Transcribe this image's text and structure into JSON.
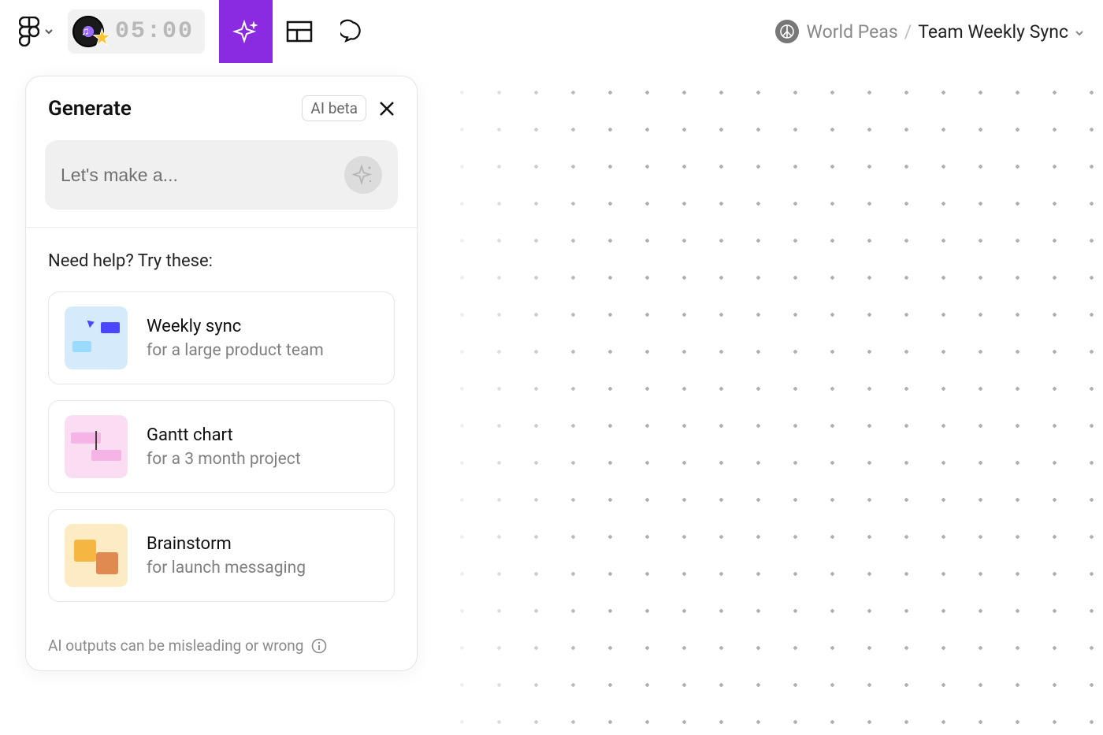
{
  "toolbar": {
    "timer": "05:00"
  },
  "breadcrumb": {
    "project": "World Peas",
    "file": "Team Weekly Sync"
  },
  "panel": {
    "title": "Generate",
    "badge": "AI beta",
    "prompt_placeholder": "Let's make a...",
    "help_title": "Need help? Try these:",
    "suggestions": [
      {
        "title": "Weekly sync",
        "sub": "for a large product team"
      },
      {
        "title": "Gantt chart",
        "sub": "for a 3 month project"
      },
      {
        "title": "Brainstorm",
        "sub": "for launch messaging"
      }
    ],
    "disclaimer": "AI outputs can be misleading or wrong"
  }
}
